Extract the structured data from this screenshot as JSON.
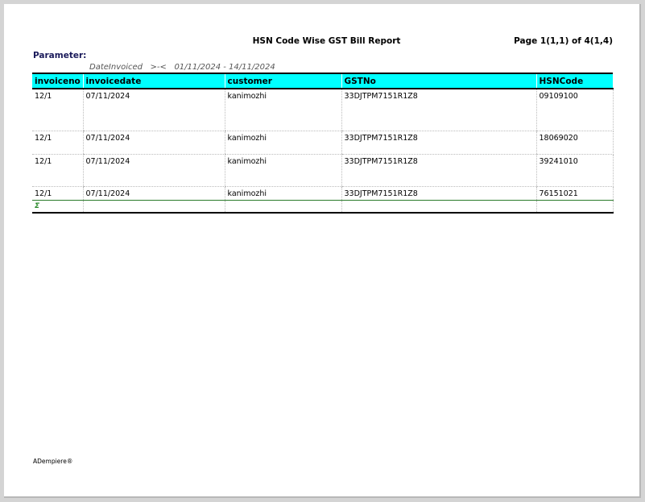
{
  "report": {
    "title": "HSN Code Wise GST Bill Report",
    "page_info": "Page 1(1,1) of 4(1,4)",
    "parameter_label": "Parameter:",
    "parameter_line": "DateInvoiced   >-<   01/11/2024 - 14/11/2024"
  },
  "table": {
    "columns": [
      "invoiceno",
      "invoicedate",
      "customer",
      "GSTNo",
      "HSNCode"
    ],
    "rows": [
      [
        "12/1",
        "07/11/2024",
        "kanimozhi",
        "33DJTPM7151R1Z8",
        "09109100"
      ],
      [
        "12/1",
        "07/11/2024",
        "kanimozhi",
        "33DJTPM7151R1Z8",
        "18069020"
      ],
      [
        "12/1",
        "07/11/2024",
        "kanimozhi",
        "33DJTPM7151R1Z8",
        "39241010"
      ],
      [
        "12/1",
        "07/11/2024",
        "kanimozhi",
        "33DJTPM7151R1Z8",
        "76151021"
      ]
    ],
    "total_symbol": "Σ"
  },
  "footer": {
    "brand": "ADempiere®"
  },
  "colors": {
    "header_bg": "#00ffff",
    "total_line": "#2a7a2a",
    "param_label": "#1a1a5a"
  }
}
